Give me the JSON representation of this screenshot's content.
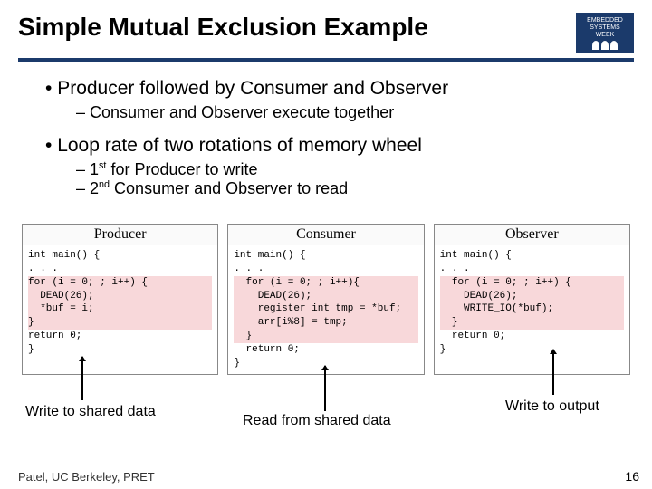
{
  "header": {
    "title": "Simple Mutual Exclusion Example",
    "logo_line1": "EMBEDDED",
    "logo_line2": "SYSTEMS",
    "logo_line3": "WEEK"
  },
  "bullets": {
    "b1": "Producer followed by Consumer and Observer",
    "b1_sub1": "Consumer and Observer execute together",
    "b2": "Loop rate of two rotations of memory wheel",
    "b2_sub1_pre": "1",
    "b2_sub1_sup": "st",
    "b2_sub1_post": " for Producer to write",
    "b2_sub2_pre": "2",
    "b2_sub2_sup": "nd",
    "b2_sub2_post": " Consumer and Observer to read"
  },
  "panels": {
    "producer": {
      "title": "Producer",
      "l1": "int main() {",
      "l2": ". . .",
      "l3": "for (i = 0; ; i++) {",
      "l4": "  DEAD(26);",
      "l5": "  *buf = i;",
      "l6": "}",
      "l7": "return 0;",
      "l8": "}"
    },
    "consumer": {
      "title": "Consumer",
      "l1": "int main() {",
      "l2": ". . .",
      "l3": "  for (i = 0; ; i++){",
      "l4": "    DEAD(26);",
      "l5": "    register int tmp = *buf;",
      "l6": "    arr[i%8] = tmp;",
      "l7": "  }",
      "l8": "  return 0;",
      "l9": "}"
    },
    "observer": {
      "title": "Observer",
      "l1": "int main() {",
      "l2": ". . .",
      "l3": "  for (i = 0; ; i++) {",
      "l4": "    DEAD(26);",
      "l5": "    WRITE_IO(*buf);",
      "l6": "  }",
      "l7": "  return 0;",
      "l8": "}"
    }
  },
  "annotations": {
    "a1": "Write to shared data",
    "a2": "Read from shared data",
    "a3": "Write to output"
  },
  "footer": {
    "credit": "Patel, UC Berkeley, PRET",
    "page": "16"
  }
}
